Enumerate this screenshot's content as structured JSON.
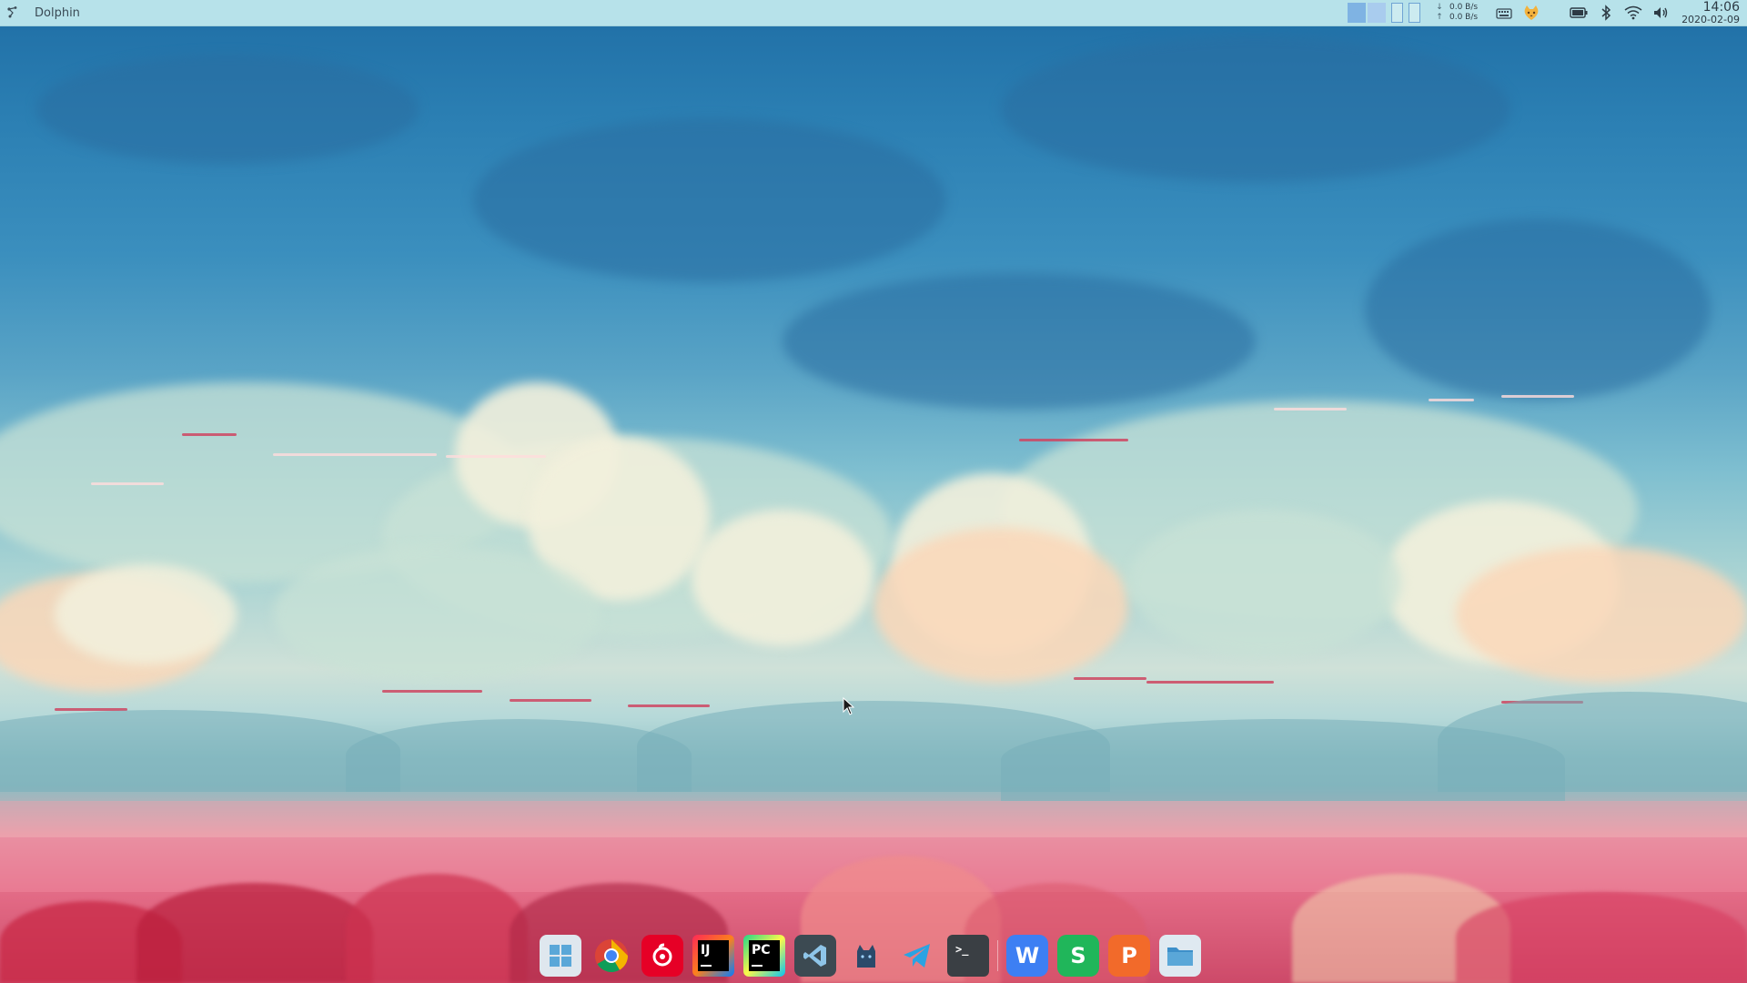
{
  "top_panel": {
    "active_window_title": "Dolphin",
    "app_menu_icon": "app-launcher-icon",
    "virtual_desktops": [
      "desktop-1",
      "desktop-2",
      "desktop-3",
      "desktop-4"
    ],
    "network": {
      "download_label": "0.0 B/s",
      "upload_label": "0.0 B/s"
    },
    "tray_icons": [
      "keyboard-icon",
      "cat-icon",
      "battery-icon",
      "bluetooth-icon",
      "wifi-icon",
      "volume-icon"
    ],
    "clock": {
      "time": "14:06",
      "date": "2020-02-09"
    }
  },
  "dock": {
    "items": [
      {
        "name": "windows-start-icon",
        "color": "#e8eef4"
      },
      {
        "name": "chrome-icon",
        "color": "#4285f4"
      },
      {
        "name": "netease-music-icon",
        "color": "#e60026"
      },
      {
        "name": "intellij-idea-icon",
        "color": "#000000"
      },
      {
        "name": "pycharm-icon",
        "color": "#21d789"
      },
      {
        "name": "vscode-icon",
        "color": "#3c4a52"
      },
      {
        "name": "cat-app-icon",
        "color": "#2b4a6a"
      },
      {
        "name": "telegram-icon",
        "color": "#2aa3e2"
      },
      {
        "name": "terminal-icon",
        "color": "#3a3f44"
      },
      {
        "name": "wps-writer-icon",
        "color": "#3d7ff3"
      },
      {
        "name": "wps-spreadsheet-icon",
        "color": "#20b65a"
      },
      {
        "name": "wps-presentation-icon",
        "color": "#f26a2a"
      },
      {
        "name": "file-manager-icon",
        "color": "#5aa7d8"
      }
    ]
  },
  "wallpaper": {
    "sky_color": "#2b7fb3",
    "cloud_color": "#f2f0dc",
    "field_color": "#e98095"
  }
}
